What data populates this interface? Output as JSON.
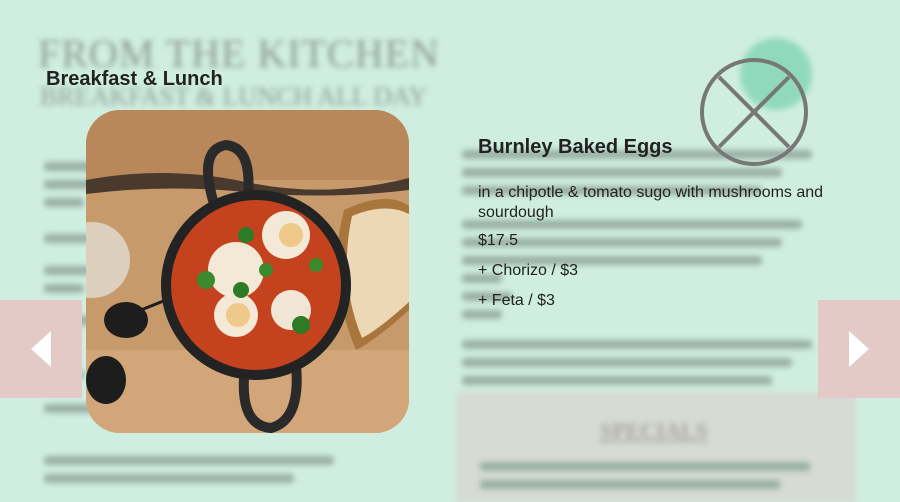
{
  "background": {
    "title": "FROM THE KITCHEN",
    "subtitle": "BREAKFAST & LUNCH ALL DAY",
    "specials": "SPECIALS"
  },
  "modal": {
    "section_title": "Breakfast & Lunch",
    "dish": {
      "name": "Burnley Baked Eggs",
      "description": "in a chipotle & tomato sugo with mushrooms and sourdough",
      "price": "$17.5",
      "extras": [
        "+ Chorizo / $3",
        "+ Feta / $3"
      ]
    }
  },
  "controls": {
    "close_icon": "close-icon",
    "prev_icon": "chevron-left-icon",
    "next_icon": "chevron-right-icon"
  },
  "colors": {
    "background": "#cfeee0",
    "arrow_bg": "#e3cac6",
    "close_stroke": "#777777"
  }
}
